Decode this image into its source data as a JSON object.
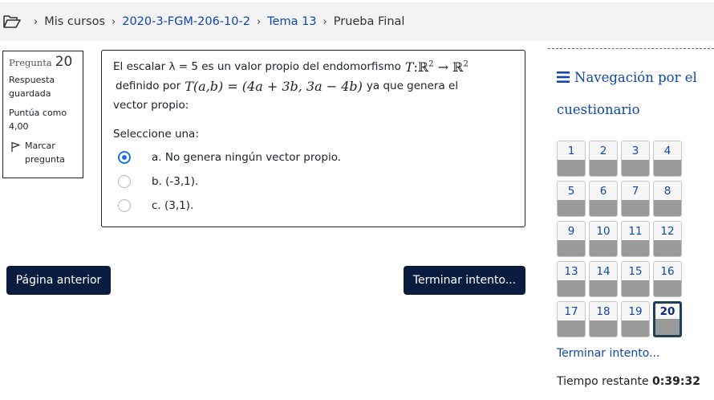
{
  "breadcrumb": {
    "items": [
      {
        "label": "Mis cursos",
        "link": false
      },
      {
        "label": "2020-3-FGM-206-10-2",
        "link": true
      },
      {
        "label": "Tema 13",
        "link": true
      },
      {
        "label": "Prueba Final",
        "link": false
      }
    ]
  },
  "question_info": {
    "label": "Pregunta",
    "number": "20",
    "state": "Respuesta guardada",
    "grade": "Puntúa como 4,00",
    "flag_label": "Marcar pregunta"
  },
  "question": {
    "text_1": "El escalar λ = 5 es un valor propio del endomorfismo",
    "math_map_T": "T",
    "math_map_domain": "ℝ",
    "math_map_sup": "2",
    "math_map_codomain": "ℝ",
    "text_2": "definido por",
    "math_formula": "T(a,b) = (4a + 3b, 3a − 4b)",
    "text_3": "ya que genera el",
    "text_4": "vector propio:",
    "prompt": "Seleccione una:",
    "answers": [
      {
        "label": "a. No genera ningún vector propio.",
        "checked": true
      },
      {
        "label": "b. (-3,1).",
        "checked": false
      },
      {
        "label": "c. (3,1).",
        "checked": false
      }
    ]
  },
  "buttons": {
    "prev": "Página anterior",
    "finish": "Terminar intento..."
  },
  "nav": {
    "title": "Navegación por el cuestionario",
    "questions": [
      "1",
      "2",
      "3",
      "4",
      "5",
      "6",
      "7",
      "8",
      "9",
      "10",
      "11",
      "12",
      "13",
      "14",
      "15",
      "16",
      "17",
      "18",
      "19",
      "20"
    ],
    "current": "20",
    "finish_link": "Terminar intento...",
    "timer_label": "Tiempo restante",
    "timer_value": "0:39:32"
  },
  "colors": {
    "primary_button": "#0a1c3f",
    "link": "#0f47ad",
    "radio_checked": "#1f6fe0"
  }
}
